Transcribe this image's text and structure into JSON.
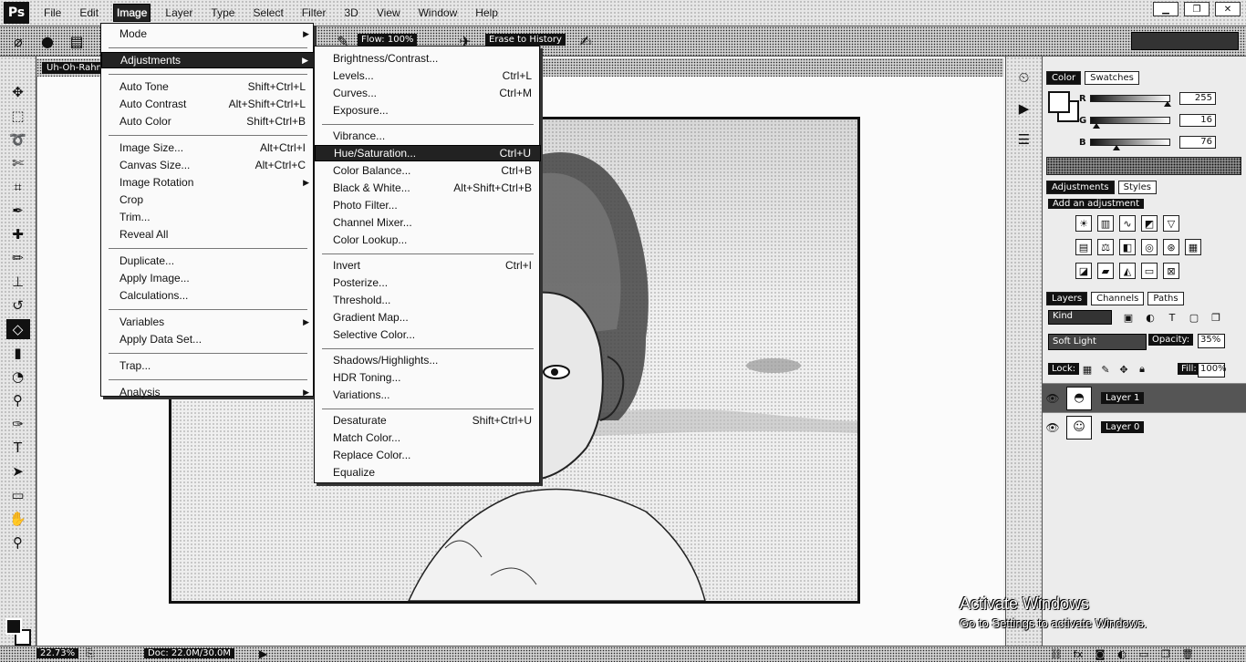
{
  "app": {
    "logo": "Ps"
  },
  "menubar": {
    "items": [
      "File",
      "Edit",
      "Image",
      "Layer",
      "Type",
      "Select",
      "Filter",
      "3D",
      "View",
      "Window",
      "Help"
    ],
    "active": "Image",
    "window_controls": [
      "▁",
      "❐",
      "✕"
    ]
  },
  "options_bar": {
    "flow_label": "Flow:",
    "flow_value": "100%",
    "erase_to_history": "Erase to History"
  },
  "document": {
    "tab_label": "Uh-Oh-Rahman",
    "zoom": "22.73%",
    "doc_info": "Doc: 22.0M/30.0M"
  },
  "image_menu": {
    "items": [
      {
        "label": "Mode",
        "shortcut": "",
        "submenu": true
      },
      {
        "separator": true
      },
      {
        "label": "Adjustments",
        "shortcut": "",
        "submenu": true,
        "highlighted": true
      },
      {
        "separator": true
      },
      {
        "label": "Auto Tone",
        "shortcut": "Shift+Ctrl+L"
      },
      {
        "label": "Auto Contrast",
        "shortcut": "Alt+Shift+Ctrl+L"
      },
      {
        "label": "Auto Color",
        "shortcut": "Shift+Ctrl+B"
      },
      {
        "separator": true
      },
      {
        "label": "Image Size...",
        "shortcut": "Alt+Ctrl+I"
      },
      {
        "label": "Canvas Size...",
        "shortcut": "Alt+Ctrl+C"
      },
      {
        "label": "Image Rotation",
        "shortcut": "",
        "submenu": true
      },
      {
        "label": "Crop",
        "shortcut": ""
      },
      {
        "label": "Trim...",
        "shortcut": ""
      },
      {
        "label": "Reveal All",
        "shortcut": ""
      },
      {
        "separator": true
      },
      {
        "label": "Duplicate...",
        "shortcut": ""
      },
      {
        "label": "Apply Image...",
        "shortcut": ""
      },
      {
        "label": "Calculations...",
        "shortcut": ""
      },
      {
        "separator": true
      },
      {
        "label": "Variables",
        "shortcut": "",
        "submenu": true
      },
      {
        "label": "Apply Data Set...",
        "shortcut": ""
      },
      {
        "separator": true
      },
      {
        "label": "Trap...",
        "shortcut": ""
      },
      {
        "separator": true
      },
      {
        "label": "Analysis",
        "shortcut": "",
        "submenu": true
      }
    ]
  },
  "adjustments_menu": {
    "items": [
      {
        "label": "Brightness/Contrast...",
        "shortcut": ""
      },
      {
        "label": "Levels...",
        "shortcut": "Ctrl+L"
      },
      {
        "label": "Curves...",
        "shortcut": "Ctrl+M"
      },
      {
        "label": "Exposure...",
        "shortcut": ""
      },
      {
        "separator": true
      },
      {
        "label": "Vibrance...",
        "shortcut": ""
      },
      {
        "label": "Hue/Saturation...",
        "shortcut": "Ctrl+U",
        "highlighted": true
      },
      {
        "label": "Color Balance...",
        "shortcut": "Ctrl+B"
      },
      {
        "label": "Black & White...",
        "shortcut": "Alt+Shift+Ctrl+B"
      },
      {
        "label": "Photo Filter...",
        "shortcut": ""
      },
      {
        "label": "Channel Mixer...",
        "shortcut": ""
      },
      {
        "label": "Color Lookup...",
        "shortcut": ""
      },
      {
        "separator": true
      },
      {
        "label": "Invert",
        "shortcut": "Ctrl+I"
      },
      {
        "label": "Posterize...",
        "shortcut": ""
      },
      {
        "label": "Threshold...",
        "shortcut": ""
      },
      {
        "label": "Gradient Map...",
        "shortcut": ""
      },
      {
        "label": "Selective Color...",
        "shortcut": ""
      },
      {
        "separator": true
      },
      {
        "label": "Shadows/Highlights...",
        "shortcut": ""
      },
      {
        "label": "HDR Toning...",
        "shortcut": ""
      },
      {
        "label": "Variations...",
        "shortcut": ""
      },
      {
        "separator": true
      },
      {
        "label": "Desaturate",
        "shortcut": "Shift+Ctrl+U"
      },
      {
        "label": "Match Color...",
        "shortcut": ""
      },
      {
        "label": "Replace Color...",
        "shortcut": ""
      },
      {
        "label": "Equalize",
        "shortcut": ""
      }
    ]
  },
  "color_panel": {
    "tabs": [
      "Color",
      "Swatches"
    ],
    "sliders": [
      {
        "letter": "R",
        "value": "255",
        "level": 0.95
      },
      {
        "letter": "G",
        "value": "16",
        "level": 0.05
      },
      {
        "letter": "B",
        "value": "76",
        "level": 0.3
      }
    ]
  },
  "adjustments_panel": {
    "tabs": [
      "Adjustments",
      "Styles"
    ],
    "title": "Add an adjustment"
  },
  "layers_panel": {
    "tabs": [
      "Layers",
      "Channels",
      "Paths"
    ],
    "filter_kind": "Kind",
    "blend_mode": "Soft Light",
    "opacity_label": "Opacity:",
    "opacity_value": "35%",
    "lock_label": "Lock:",
    "fill_label": "Fill:",
    "fill_value": "100%",
    "layers": [
      {
        "name": "Layer 1",
        "selected": true
      },
      {
        "name": "Layer 0",
        "selected": false
      }
    ]
  },
  "watermark": {
    "line1": "Activate Windows",
    "line2": "Go to Settings to activate Windows."
  }
}
